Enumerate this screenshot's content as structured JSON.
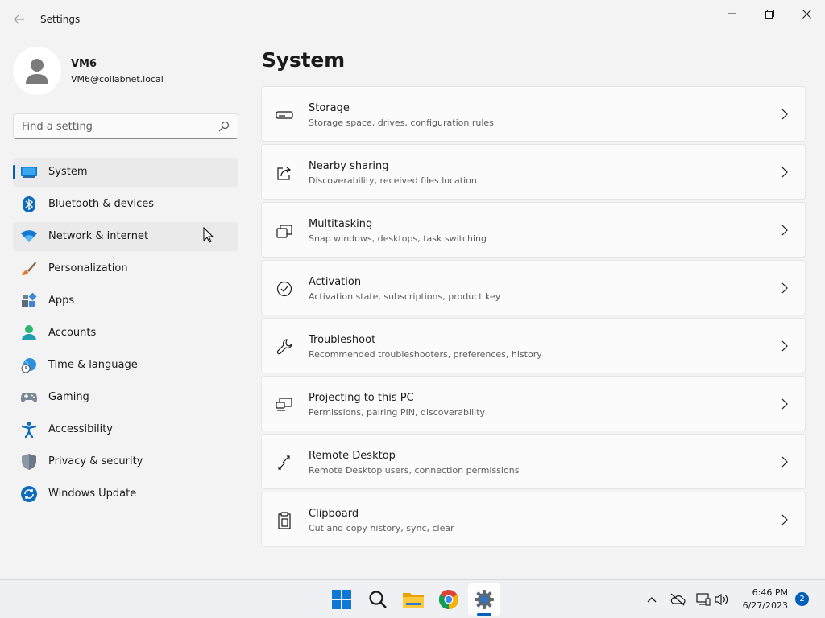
{
  "window": {
    "title": "Settings"
  },
  "profile": {
    "name": "VM6",
    "email": "VM6@collabnet.local"
  },
  "search": {
    "placeholder": "Find a setting"
  },
  "sidebar": {
    "items": [
      {
        "label": "System",
        "icon": "system-icon",
        "selected": true
      },
      {
        "label": "Bluetooth & devices",
        "icon": "bluetooth-icon"
      },
      {
        "label": "Network & internet",
        "icon": "wifi-icon"
      },
      {
        "label": "Personalization",
        "icon": "brush-icon"
      },
      {
        "label": "Apps",
        "icon": "apps-icon"
      },
      {
        "label": "Accounts",
        "icon": "accounts-icon"
      },
      {
        "label": "Time & language",
        "icon": "globe-clock-icon"
      },
      {
        "label": "Gaming",
        "icon": "gamepad-icon"
      },
      {
        "label": "Accessibility",
        "icon": "accessibility-icon"
      },
      {
        "label": "Privacy & security",
        "icon": "shield-icon"
      },
      {
        "label": "Windows Update",
        "icon": "update-icon"
      }
    ]
  },
  "main": {
    "title": "System",
    "cards": [
      {
        "title": "Storage",
        "subtitle": "Storage space, drives, configuration rules",
        "icon": "storage-icon"
      },
      {
        "title": "Nearby sharing",
        "subtitle": "Discoverability, received files location",
        "icon": "share-icon"
      },
      {
        "title": "Multitasking",
        "subtitle": "Snap windows, desktops, task switching",
        "icon": "multitasking-icon"
      },
      {
        "title": "Activation",
        "subtitle": "Activation state, subscriptions, product key",
        "icon": "check-circle-icon"
      },
      {
        "title": "Troubleshoot",
        "subtitle": "Recommended troubleshooters, preferences, history",
        "icon": "wrench-icon"
      },
      {
        "title": "Projecting to this PC",
        "subtitle": "Permissions, pairing PIN, discoverability",
        "icon": "projecting-icon"
      },
      {
        "title": "Remote Desktop",
        "subtitle": "Remote Desktop users, connection permissions",
        "icon": "remote-desktop-icon"
      },
      {
        "title": "Clipboard",
        "subtitle": "Cut and copy history, sync, clear",
        "icon": "clipboard-icon"
      }
    ]
  },
  "taskbar": {
    "apps": [
      "windows-start-icon",
      "search-icon",
      "file-explorer-icon",
      "chrome-icon",
      "settings-icon"
    ],
    "clock": {
      "time": "6:46 PM",
      "date": "6/27/2023"
    },
    "notifications": "2"
  },
  "colors": {
    "accent": "#005fb8",
    "background": "#f3f3f3",
    "card": "#fbfbfb"
  }
}
